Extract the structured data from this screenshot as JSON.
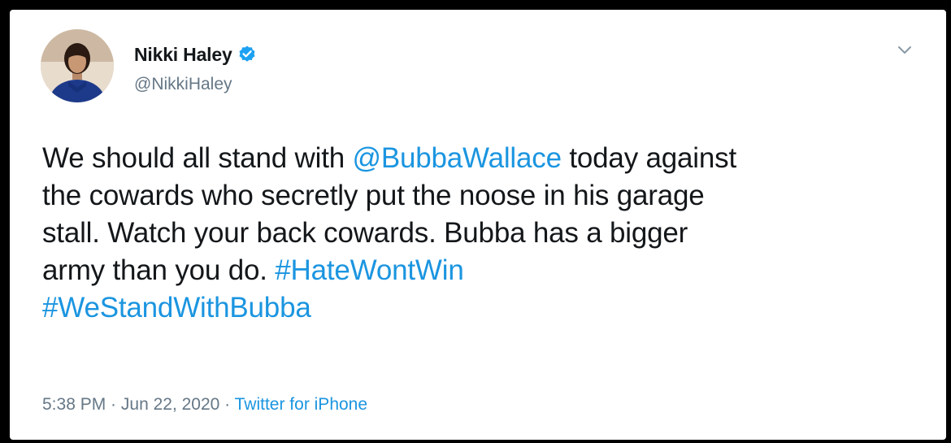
{
  "author": {
    "display_name": "Nikki Haley",
    "handle": "@NikkiHaley",
    "verified": true
  },
  "tweet": {
    "line1_pre": "We should all stand with ",
    "mention": "@BubbaWallace",
    "line1_post": " today against",
    "line2": "the cowards who secretly put the noose in his garage",
    "line3": "stall. Watch your back cowards. Bubba has a bigger",
    "line4_pre": "army than you do. ",
    "hashtag1": "#HateWontWin",
    "hashtag2": "#WeStandWithBubba"
  },
  "meta": {
    "time": "5:38 PM",
    "separator1": " · ",
    "date": "Jun 22, 2020",
    "separator2": " · ",
    "source": "Twitter for iPhone"
  },
  "icons": {
    "verified": "verified-badge-icon",
    "menu": "chevron-down-icon"
  },
  "colors": {
    "link": "#1b95e0",
    "secondary_text": "#657786",
    "primary_text": "#14171a",
    "verified_blue": "#1da1f2"
  }
}
